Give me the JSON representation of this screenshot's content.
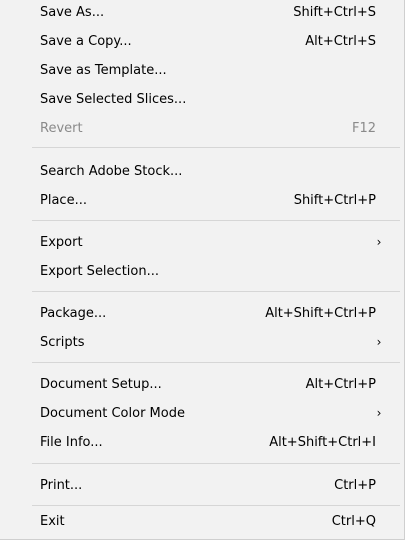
{
  "menu": {
    "items": [
      {
        "label": "Save As...",
        "shortcut": "Shift+Ctrl+S"
      },
      {
        "label": "Save a Copy...",
        "shortcut": "Alt+Ctrl+S"
      },
      {
        "label": "Save as Template...",
        "shortcut": ""
      },
      {
        "label": "Save Selected Slices...",
        "shortcut": ""
      },
      {
        "label": "Revert",
        "shortcut": "F12"
      },
      {
        "label": "Search Adobe Stock...",
        "shortcut": ""
      },
      {
        "label": "Place...",
        "shortcut": "Shift+Ctrl+P"
      },
      {
        "label": "Export",
        "shortcut": "",
        "submenu": "›"
      },
      {
        "label": "Export Selection...",
        "shortcut": ""
      },
      {
        "label": "Package...",
        "shortcut": "Alt+Shift+Ctrl+P"
      },
      {
        "label": "Scripts",
        "shortcut": "",
        "submenu": "›"
      },
      {
        "label": "Document Setup...",
        "shortcut": "Alt+Ctrl+P"
      },
      {
        "label": "Document Color Mode",
        "shortcut": "",
        "submenu": "›"
      },
      {
        "label": "File Info...",
        "shortcut": "Alt+Shift+Ctrl+I"
      },
      {
        "label": "Print...",
        "shortcut": "Ctrl+P"
      },
      {
        "label": "Exit",
        "shortcut": "Ctrl+Q"
      }
    ]
  }
}
